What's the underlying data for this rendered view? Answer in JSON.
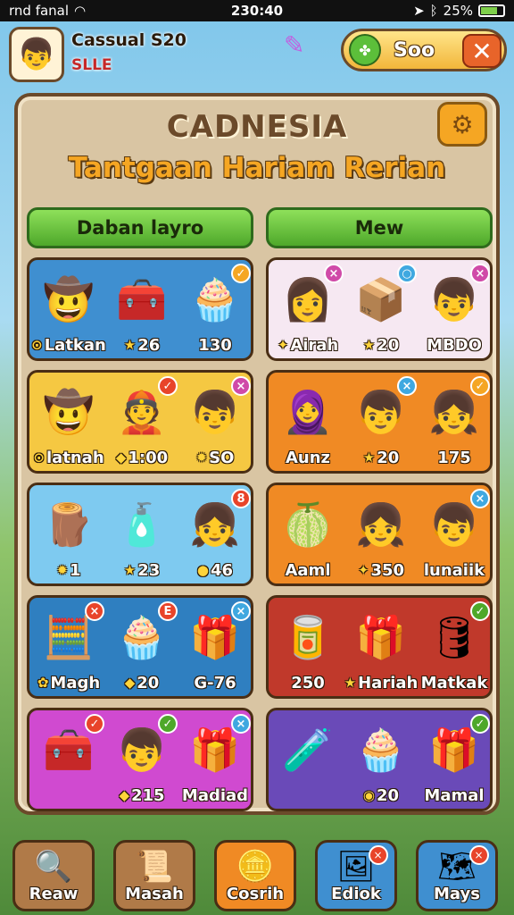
{
  "status": {
    "carrier": "rnd fanal",
    "time": "230:40",
    "battery": "25%"
  },
  "player": {
    "name": "Cassual S20",
    "rank": "SLLE",
    "avatar_icon": "boy-avatar-icon"
  },
  "currency": {
    "value": "Soo",
    "icon": "clover-coin-icon"
  },
  "header": {
    "title": "CADNESIA",
    "subtitle": "Tantgaan Hariam Rerian"
  },
  "tabs": [
    {
      "label": "Daban layro"
    },
    {
      "label": "Mew"
    }
  ],
  "cards": [
    {
      "color": "#3f8fd0",
      "slots": [
        {
          "glyph": "🤠",
          "badge": "",
          "badge_color": "",
          "label": "Latkan",
          "label_icon": "⊙"
        },
        {
          "glyph": "🧰",
          "badge": "",
          "badge_color": "",
          "label": "26",
          "label_icon": "★"
        },
        {
          "glyph": "🧁",
          "badge": "✓",
          "badge_color": "#f5a623",
          "label": "130",
          "label_icon": ""
        }
      ]
    },
    {
      "color": "#f6e8f2",
      "slots": [
        {
          "glyph": "👩",
          "badge": "×",
          "badge_color": "#d04aa8",
          "label": "Airah",
          "label_icon": "✦"
        },
        {
          "glyph": "📦",
          "badge": "○",
          "badge_color": "#3fa8e0",
          "label": "20",
          "label_icon": "★"
        },
        {
          "glyph": "👦",
          "badge": "×",
          "badge_color": "#d04aa8",
          "label": "MBDO",
          "label_icon": ""
        }
      ]
    },
    {
      "color": "#f5c842",
      "slots": [
        {
          "glyph": "🤠",
          "badge": "",
          "badge_color": "",
          "label": "latnah",
          "label_icon": "⊙"
        },
        {
          "glyph": "👲",
          "badge": "✓",
          "badge_color": "#e8442a",
          "label": "1:00",
          "label_icon": "◆"
        },
        {
          "glyph": "👦",
          "badge": "×",
          "badge_color": "#d04aa8",
          "label": "SO",
          "label_icon": "✹"
        }
      ]
    },
    {
      "color": "#f08a24",
      "slots": [
        {
          "glyph": "🧕",
          "badge": "",
          "badge_color": "",
          "label": "Aunz",
          "label_icon": ""
        },
        {
          "glyph": "👦",
          "badge": "×",
          "badge_color": "#3fa8e0",
          "label": "20",
          "label_icon": "★"
        },
        {
          "glyph": "👧",
          "badge": "✓",
          "badge_color": "#f5a623",
          "label": "175",
          "label_icon": ""
        }
      ]
    },
    {
      "color": "#7ecaf0",
      "slots": [
        {
          "glyph": "🪵",
          "badge": "",
          "badge_color": "",
          "label": "1",
          "label_icon": "✹"
        },
        {
          "glyph": "🧴",
          "badge": "",
          "badge_color": "",
          "label": "23",
          "label_icon": "★"
        },
        {
          "glyph": "👧",
          "badge": "8",
          "badge_color": "#e8442a",
          "label": "46",
          "label_icon": "●"
        }
      ]
    },
    {
      "color": "#f08a24",
      "slots": [
        {
          "glyph": "🍈",
          "badge": "",
          "badge_color": "",
          "label": "Aaml",
          "label_icon": ""
        },
        {
          "glyph": "👧",
          "badge": "",
          "badge_color": "",
          "label": "350",
          "label_icon": "✦"
        },
        {
          "glyph": "👦",
          "badge": "×",
          "badge_color": "#3fa8e0",
          "label": "lunaiik",
          "label_icon": ""
        }
      ]
    },
    {
      "color": "#2f7fc0",
      "slots": [
        {
          "glyph": "🧮",
          "badge": "×",
          "badge_color": "#e8442a",
          "label": "Magh",
          "label_icon": "✿"
        },
        {
          "glyph": "🧁",
          "badge": "E",
          "badge_color": "#e8442a",
          "label": "20",
          "label_icon": "◆"
        },
        {
          "glyph": "🎁",
          "badge": "×",
          "badge_color": "#3fa8e0",
          "label": "G-76",
          "label_icon": ""
        }
      ]
    },
    {
      "color": "#c0392b",
      "slots": [
        {
          "glyph": "🥫",
          "badge": "",
          "badge_color": "",
          "label": "250",
          "label_icon": ""
        },
        {
          "glyph": "🎁",
          "badge": "",
          "badge_color": "",
          "label": "Hariah",
          "label_icon": "★"
        },
        {
          "glyph": "🛢",
          "badge": "✓",
          "badge_color": "#4ea82a",
          "label": "Matkak",
          "label_icon": ""
        }
      ]
    },
    {
      "color": "#d04ad0",
      "slots": [
        {
          "glyph": "🧰",
          "badge": "✓",
          "badge_color": "#e8442a",
          "label": "",
          "label_icon": ""
        },
        {
          "glyph": "👦",
          "badge": "✓",
          "badge_color": "#4ea82a",
          "label": "215",
          "label_icon": "◆"
        },
        {
          "glyph": "🎁",
          "badge": "×",
          "badge_color": "#3fa8e0",
          "label": "Madiad",
          "label_icon": ""
        }
      ]
    },
    {
      "color": "#6a4ab8",
      "slots": [
        {
          "glyph": "🧪",
          "badge": "",
          "badge_color": "",
          "label": "",
          "label_icon": ""
        },
        {
          "glyph": "🧁",
          "badge": "",
          "badge_color": "",
          "label": "20",
          "label_icon": "◉"
        },
        {
          "glyph": "🎁",
          "badge": "✓",
          "badge_color": "#4ea82a",
          "label": "Mamal",
          "label_icon": ""
        }
      ]
    }
  ],
  "nav": [
    {
      "label": "Reaw",
      "glyph": "🔍",
      "badge": "",
      "color": "#b07a48"
    },
    {
      "label": "Masah",
      "glyph": "📜",
      "badge": "",
      "color": "#b07a48"
    },
    {
      "label": "Cosrih",
      "glyph": "🪙",
      "badge": "",
      "color": "#f08a24"
    },
    {
      "label": "Ediok",
      "glyph": "🖼",
      "badge": "×",
      "color": "#3f8fd0"
    },
    {
      "label": "Mays",
      "glyph": "🗺",
      "badge": "×",
      "color": "#3f8fd0"
    }
  ]
}
